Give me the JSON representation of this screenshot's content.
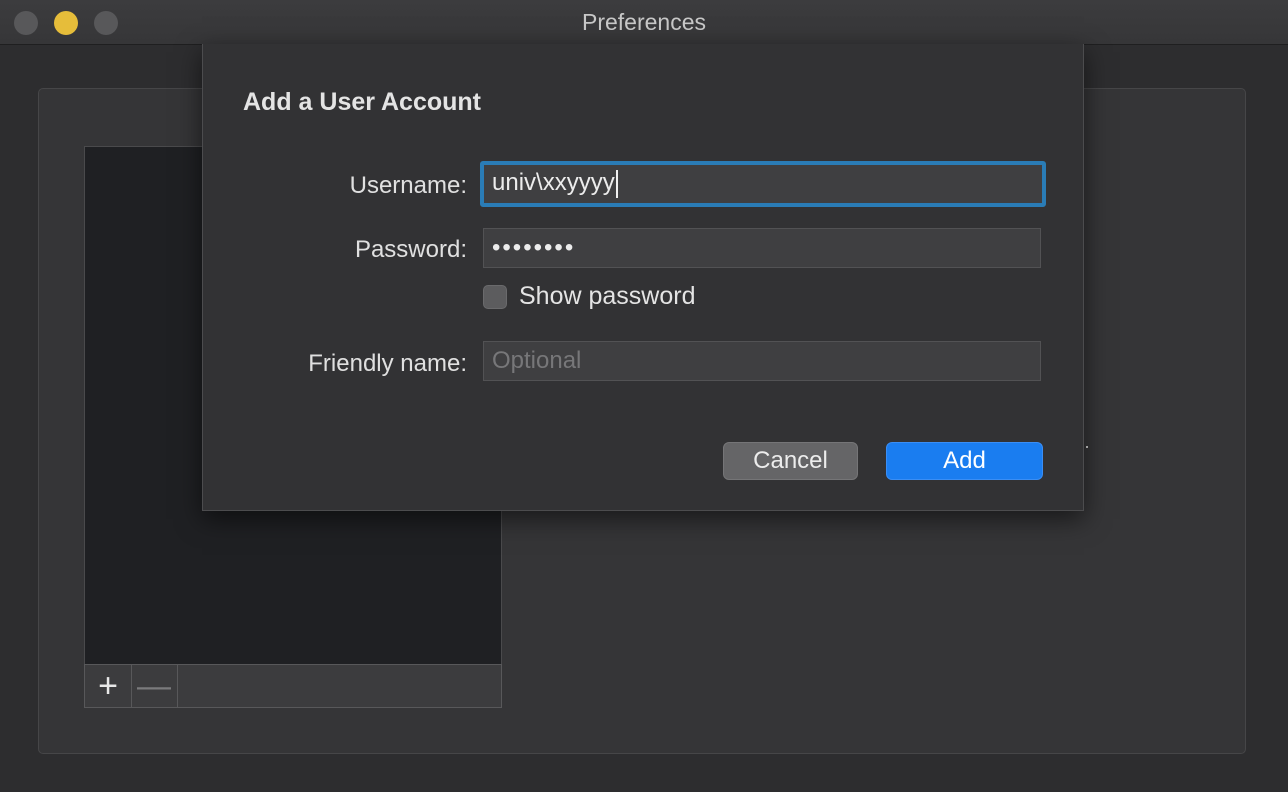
{
  "window": {
    "title": "Preferences"
  },
  "accounts_toolbar": {
    "add_symbol": "+",
    "remove_symbol": "—"
  },
  "dialog": {
    "title": "Add a User Account",
    "username_label": "Username:",
    "username_value": "univ\\xxyyyy",
    "password_label": "Password:",
    "password_value": "••••••••",
    "show_password_label": "Show password",
    "show_password_checked": false,
    "friendly_name_label": "Friendly name:",
    "friendly_name_value": "",
    "friendly_name_placeholder": "Optional",
    "cancel_label": "Cancel",
    "add_label": "Add"
  },
  "colors": {
    "accent": "#1a7df0",
    "focus_ring": "#2a7cb6",
    "minimize_button": "#e6bd3a"
  }
}
